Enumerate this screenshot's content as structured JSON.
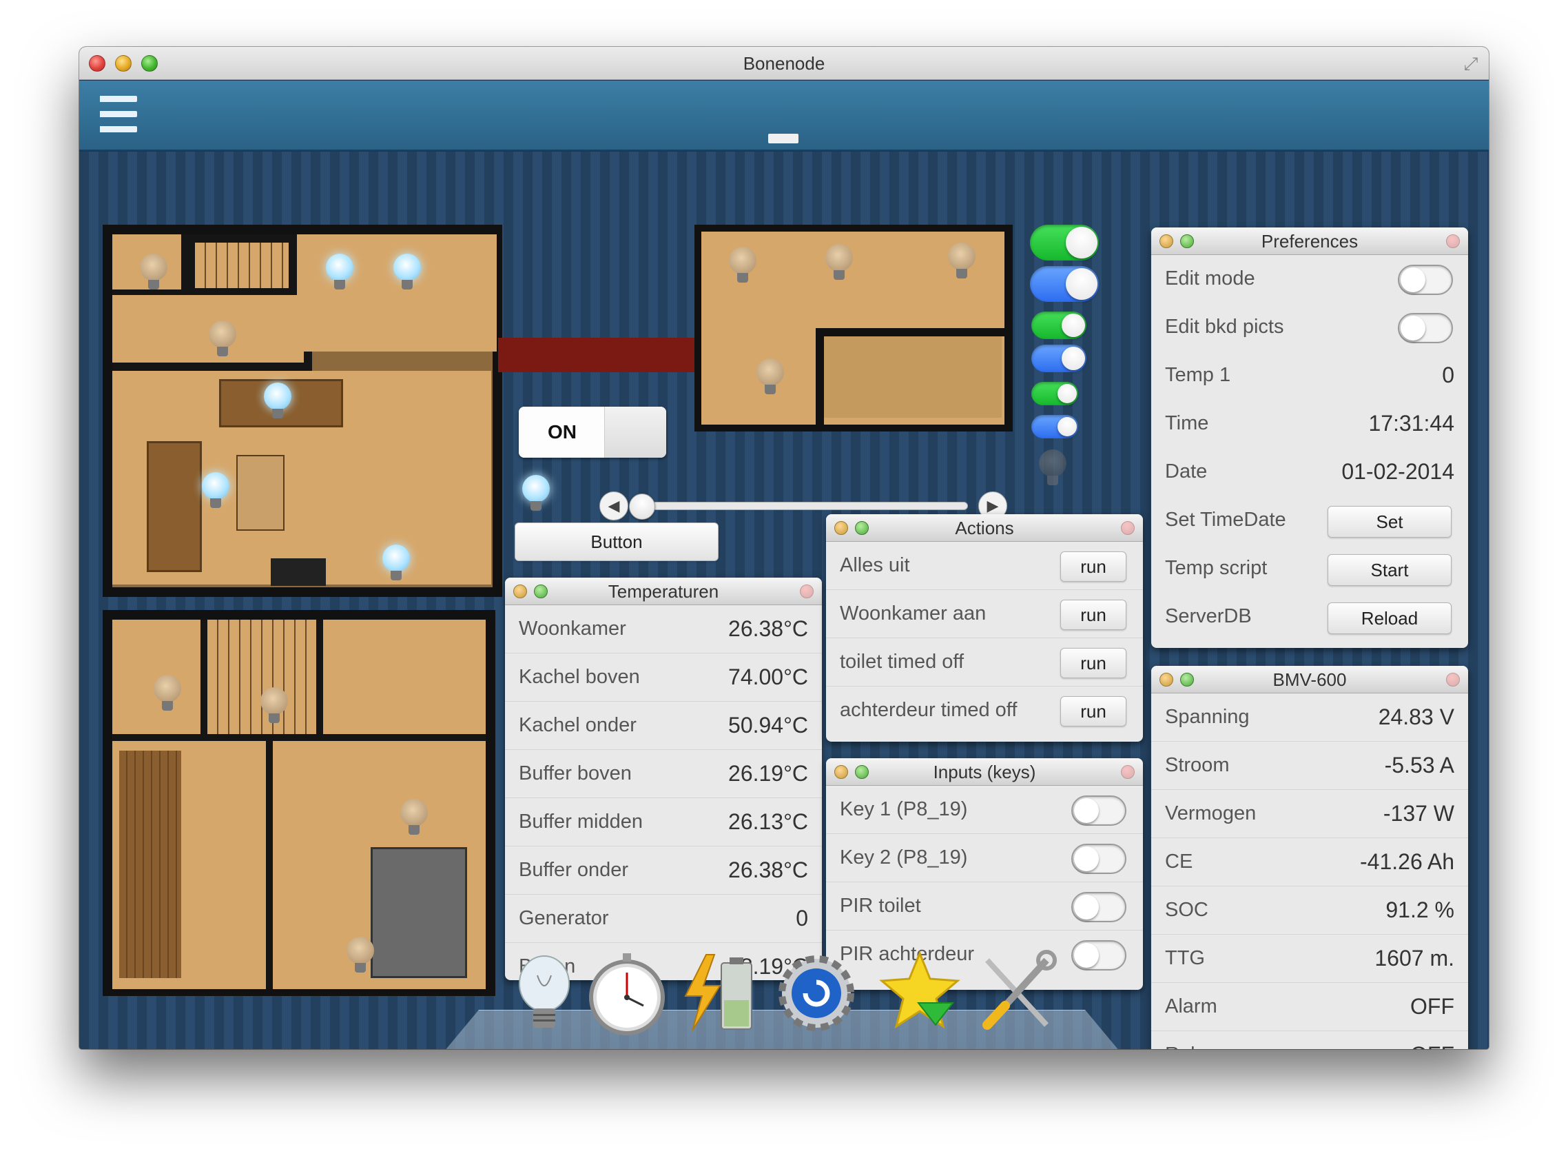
{
  "window": {
    "title": "Bonenode"
  },
  "controls": {
    "on_label": "ON",
    "button_label": "Button"
  },
  "temperatures": {
    "title": "Temperaturen",
    "rows": [
      {
        "label": "Woonkamer",
        "value": "26.38°C"
      },
      {
        "label": "Kachel boven",
        "value": "74.00°C"
      },
      {
        "label": "Kachel onder",
        "value": "50.94°C"
      },
      {
        "label": "Buffer boven",
        "value": "26.19°C"
      },
      {
        "label": "Buffer midden",
        "value": "26.13°C"
      },
      {
        "label": "Buffer onder",
        "value": "26.38°C"
      },
      {
        "label": "Generator",
        "value": "0"
      },
      {
        "label": "Buiten",
        "value": "8.19°C"
      }
    ]
  },
  "actions": {
    "title": "Actions",
    "rows": [
      {
        "label": "Alles uit",
        "button": "run"
      },
      {
        "label": "Woonkamer aan",
        "button": "run"
      },
      {
        "label": "toilet timed off",
        "button": "run"
      },
      {
        "label": "achterdeur timed off",
        "button": "run"
      }
    ]
  },
  "inputs": {
    "title": "Inputs (keys)",
    "rows": [
      {
        "label": "Key 1 (P8_19)",
        "state": "off"
      },
      {
        "label": "Key 2 (P8_19)",
        "state": "off"
      },
      {
        "label": "PIR toilet",
        "state": "off"
      },
      {
        "label": "PIR achterdeur",
        "state": "off"
      }
    ]
  },
  "preferences": {
    "title": "Preferences",
    "edit_mode": {
      "label": "Edit mode",
      "state": "off"
    },
    "edit_bkd": {
      "label": "Edit bkd picts",
      "state": "off"
    },
    "temp1": {
      "label": "Temp 1",
      "value": "0"
    },
    "time": {
      "label": "Time",
      "value": "17:31:44"
    },
    "date": {
      "label": "Date",
      "value": "01-02-2014"
    },
    "set_timedate": {
      "label": "Set TimeDate",
      "button": "Set"
    },
    "temp_script": {
      "label": "Temp script",
      "button": "Start"
    },
    "serverdb": {
      "label": "ServerDB",
      "button": "Reload"
    }
  },
  "bmv": {
    "title": "BMV-600",
    "rows": [
      {
        "label": "Spanning",
        "value": "24.83 V"
      },
      {
        "label": "Stroom",
        "value": "-5.53 A"
      },
      {
        "label": "Vermogen",
        "value": "-137 W"
      },
      {
        "label": "CE",
        "value": "-41.26 Ah"
      },
      {
        "label": "SOC",
        "value": "91.2 %"
      },
      {
        "label": "TTG",
        "value": "1607 m."
      },
      {
        "label": "Alarm",
        "value": "OFF"
      },
      {
        "label": "Relay",
        "value": "OFF"
      }
    ]
  },
  "dock": [
    "lightbulb-icon",
    "stopwatch-icon",
    "battery-icon",
    "refresh-gear-icon",
    "star-favorite-icon",
    "tools-icon"
  ]
}
